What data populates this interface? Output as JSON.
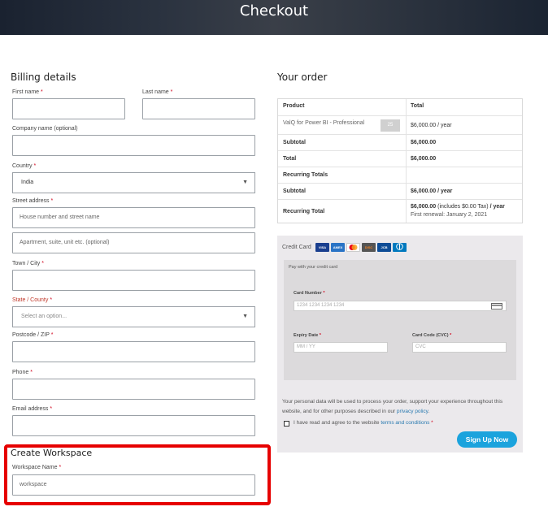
{
  "header": {
    "title": "Checkout"
  },
  "billing": {
    "title": "Billing details",
    "first_name_label": "First name",
    "last_name_label": "Last name",
    "company_label": "Company name (optional)",
    "country_label": "Country",
    "country_value": "India",
    "street_label": "Street address",
    "street_placeholder": "House number and street name",
    "street2_placeholder": "Apartment, suite, unit etc. (optional)",
    "city_label": "Town / City",
    "state_label": "State / County",
    "state_placeholder": "Select an option...",
    "postcode_label": "Postcode / ZIP",
    "phone_label": "Phone",
    "email_label": "Email address",
    "required_mark": "*"
  },
  "workspace": {
    "title": "Create Workspace",
    "name_label": "Workspace Name",
    "name_value": "workspace"
  },
  "order": {
    "title": "Your order",
    "col_product": "Product",
    "col_total": "Total",
    "item_name": "ValQ for Power BI - Professional",
    "item_qty": "25",
    "item_price": "$6,000.00 / year",
    "subtotal_label": "Subtotal",
    "subtotal_value": "$6,000.00",
    "total_label": "Total",
    "total_value": "$6,000.00",
    "recurring_label": "Recurring Totals",
    "rec_subtotal_label": "Subtotal",
    "rec_subtotal_value": "$6,000.00 / year",
    "rec_total_label": "Recurring Total",
    "rec_total_amount": "$6,000.00",
    "rec_total_tax": "(includes $0.00 Tax)",
    "rec_total_period": "/ year",
    "first_renewal": "First renewal: January 2, 2021"
  },
  "payment": {
    "method_label": "Credit Card",
    "cards": [
      "VISA",
      "AMEX",
      "MC",
      "DISC",
      "JCB",
      "DC"
    ],
    "pay_tip": "Pay with your credit card",
    "card_number_label": "Card Number",
    "card_number_placeholder": "1234 1234 1234 1234",
    "expiry_label": "Expiry Date",
    "expiry_placeholder": "MM / YY",
    "cvc_label": "Card Code (CVC)",
    "cvc_placeholder": "CVC",
    "privacy_text": "Your personal data will be used to process your order, support your experience throughout this website, and for other purposes described in our",
    "privacy_link": "privacy policy",
    "terms_text": "I have read and agree to the website",
    "terms_link": "terms and conditions",
    "submit": "Sign Up Now"
  },
  "colors": {
    "accent": "#1ba3dd",
    "required": "#d0021b",
    "highlight": "#e60000"
  }
}
